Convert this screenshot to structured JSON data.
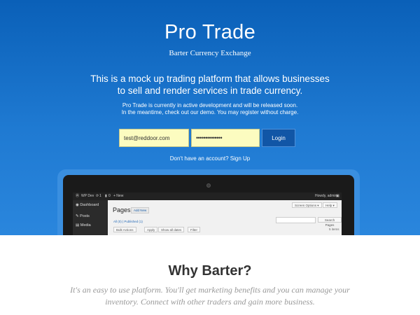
{
  "hero": {
    "title": "Pro Trade",
    "subtitle": "Barter Currency Exchange",
    "description": "This is a mock up trading platform that allows businesses to sell and render services in trade currency.",
    "note_line1": "Pro Trade is currently in active development and will be released soon.",
    "note_line2": "In the meantime, check out our demo. You may register without charge."
  },
  "login": {
    "email_value": "test@reddoor.com",
    "password_value": "••••••••••••••",
    "button_label": "Login",
    "signup_text": "Don't have an account? Sign Up"
  },
  "preview": {
    "bar_site": "WP Dev",
    "bar_updates": "1",
    "bar_comments": "0",
    "bar_new": "+ New",
    "bar_howdy": "Howdy, admin",
    "side_dashboard": "Dashboard",
    "side_posts": "Posts",
    "side_media": "Media",
    "page_title": "Pages",
    "add_new": "Add New",
    "screen_options": "Screen Options ▾",
    "help": "Help ▾",
    "filter_all": "All (0) | Published (1)",
    "search_button": "Search Pages",
    "bulk_actions": "Bulk Actions",
    "apply": "Apply",
    "all_dates": "Show all dates",
    "filter": "Filter",
    "items_count": "5 items"
  },
  "why": {
    "heading": "Why Barter?",
    "description": "It's an easy to use platform. You'll get marketing benefits and you can manage your inventory. Connect with other traders and gain more business."
  }
}
